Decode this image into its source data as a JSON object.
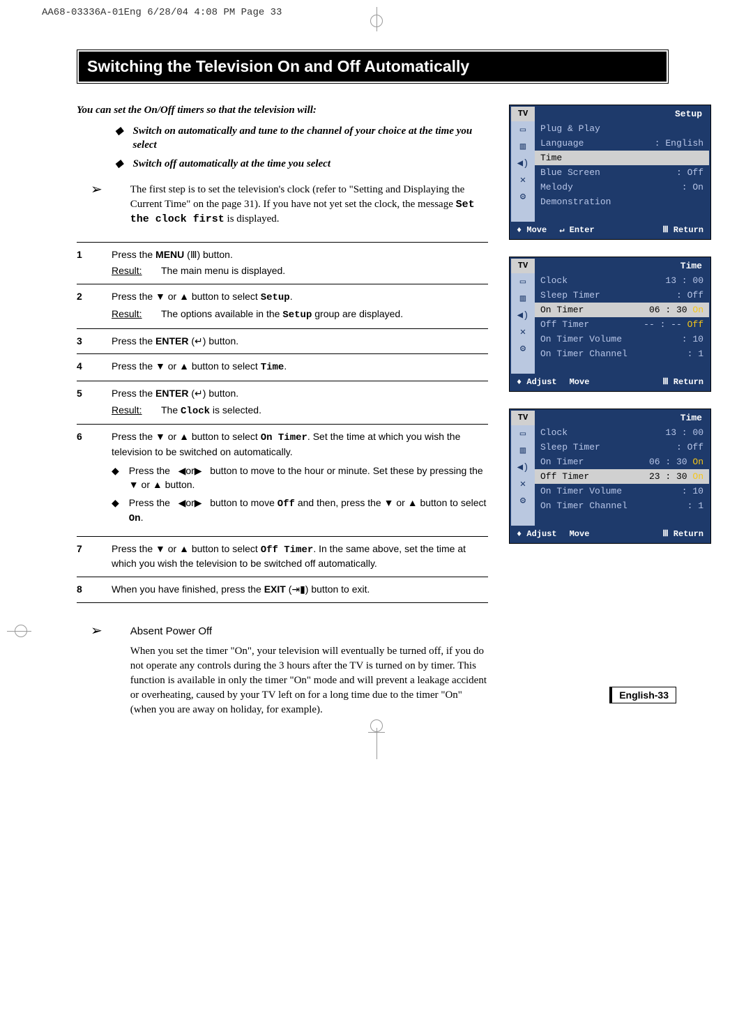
{
  "header": "AA68-03336A-01Eng  6/28/04  4:08 PM  Page 33",
  "title": "Switching the Television On and Off Automatically",
  "intro": "You can set the On/Off timers so that the television will:",
  "intro_bullets": [
    "Switch on automatically and tune to the channel of your choice at the time you select",
    "Switch off automatically at the time you select"
  ],
  "note": {
    "pre": "The first step is to set the television's clock (refer to \"Setting and Displaying the Current Time\" on the page 31). If you have not yet set the clock, the message ",
    "mono": "Set the clock first",
    "post": " is displayed."
  },
  "steps": [
    {
      "n": "1",
      "body_html": "Press the <b>MENU</b> (Ⅲ) button.",
      "result": "The main menu is displayed."
    },
    {
      "n": "2",
      "body_html": "Press the ▼ or ▲ button to select <span class='mono'>Setup</span>.",
      "result_html": "The options available in the <span class='mono'>Setup</span> group are displayed."
    },
    {
      "n": "3",
      "body_html": "Press the <b>ENTER</b> (↵) button."
    },
    {
      "n": "4",
      "body_html": "Press the ▼ or ▲ button to select <span class='mono'>Time</span>."
    },
    {
      "n": "5",
      "body_html": "Press the <b>ENTER</b> (↵) button.",
      "result_html": "The <span class='mono'>Clock</span> is selected."
    },
    {
      "n": "6",
      "body_html": "Press the ▼ or ▲ button to select <span class='mono'>On Timer</span>. Set the time at which you wish the television to be switched on automatically.",
      "subs": [
        "Press the &nbsp; ◀or▶ &nbsp; button to move to the hour or minute. Set these by pressing the ▼ or ▲ button.",
        "Press the &nbsp; ◀or▶ &nbsp; button to move <span class='mono'>Off</span> and then, press the ▼ or ▲ button to select <span class='mono'>On</span>."
      ]
    },
    {
      "n": "7",
      "body_html": "Press the ▼ or ▲ button to select <span class='mono'>Off Timer</span>. In the same above, set the time at which you wish the television to be switched off automatically."
    },
    {
      "n": "8",
      "body_html": "When you have finished, press the <b>EXIT</b> (⇥▮) button to exit."
    }
  ],
  "footer_note": {
    "title": "Absent Power Off",
    "body": "When you set the timer \"On\", your television will eventually be turned off, if you do not operate any controls during the 3 hours after the TV is turned on by timer. This function is available in only the timer \"On\" mode and will prevent a leakage accident or overheating, caused by your TV left on for a long time due to the timer \"On\" (when you are away on holiday, for example)."
  },
  "osd": [
    {
      "tv": "TV",
      "title": "Setup",
      "rows": [
        {
          "k": "Plug & Play",
          "v": ""
        },
        {
          "k": "Language",
          "v": ": English"
        },
        {
          "k": "Time",
          "v": "",
          "hl": true
        },
        {
          "k": "Blue Screen",
          "v": ": Off"
        },
        {
          "k": "Melody",
          "v": ": On"
        },
        {
          "k": "Demonstration",
          "v": ""
        }
      ],
      "footer": [
        {
          "t": "♦ Move"
        },
        {
          "t": "↵ Enter"
        },
        {
          "t": "Ⅲ Return",
          "right": true
        }
      ]
    },
    {
      "tv": "TV",
      "title": "Time",
      "rows": [
        {
          "k": "Clock",
          "v": "13 : 00"
        },
        {
          "k": "Sleep Timer",
          "v": ": Off"
        },
        {
          "k": "On Timer",
          "v": "06 : 30",
          "on": "On",
          "hl": true
        },
        {
          "k": "Off Timer",
          "v": "-- : --",
          "on": "Off"
        },
        {
          "k": "On Timer Volume",
          "v": ": 10"
        },
        {
          "k": "On Timer Channel",
          "v": ": 1"
        }
      ],
      "footer": [
        {
          "t": "♦ Adjust"
        },
        {
          "t": "Move"
        },
        {
          "t": "Ⅲ Return",
          "right": true
        }
      ]
    },
    {
      "tv": "TV",
      "title": "Time",
      "rows": [
        {
          "k": "Clock",
          "v": "13 : 00"
        },
        {
          "k": "Sleep Timer",
          "v": ": Off"
        },
        {
          "k": "On Timer",
          "v": "06 : 30",
          "on": "On"
        },
        {
          "k": "Off Timer",
          "v": "23 : 30",
          "on": "On",
          "hl": true
        },
        {
          "k": "On Timer Volume",
          "v": ": 10"
        },
        {
          "k": "On Timer Channel",
          "v": ": 1"
        }
      ],
      "footer": [
        {
          "t": "♦ Adjust"
        },
        {
          "t": "Move"
        },
        {
          "t": "Ⅲ Return",
          "right": true
        }
      ]
    }
  ],
  "page_num": "English-33",
  "labels": {
    "result": "Result:"
  }
}
